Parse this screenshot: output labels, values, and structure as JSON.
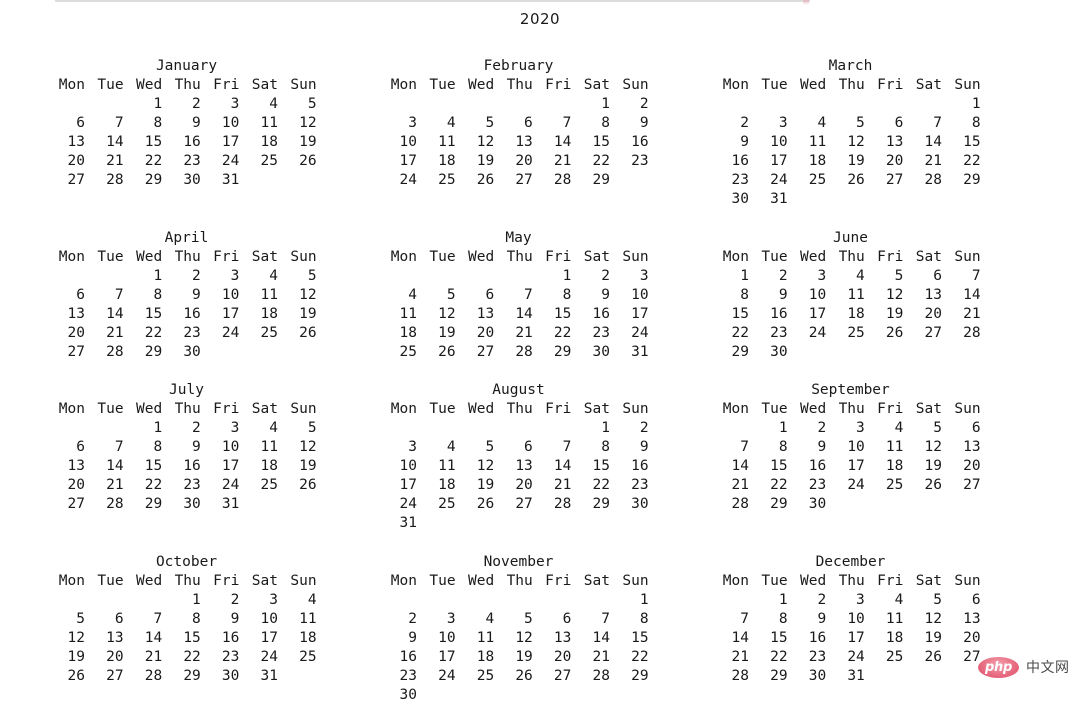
{
  "title": "2020",
  "watermark": {
    "badge_text": "php",
    "text": "中文网",
    "badge_color": "#dc4f68",
    "text_color": "#4a4a4a"
  },
  "calendar": {
    "year": "2020",
    "first_weekday": "Mon",
    "weekday_headers": [
      "Mon",
      "Tue",
      "Wed",
      "Thu",
      "Fri",
      "Sat",
      "Sun"
    ],
    "columns": 3,
    "rows": 4,
    "months": [
      {
        "name": "January",
        "index": 1,
        "weeks": [
          [
            "",
            "",
            "1",
            "2",
            "3",
            "4",
            "5"
          ],
          [
            "6",
            "7",
            "8",
            "9",
            "10",
            "11",
            "12"
          ],
          [
            "13",
            "14",
            "15",
            "16",
            "17",
            "18",
            "19"
          ],
          [
            "20",
            "21",
            "22",
            "23",
            "24",
            "25",
            "26"
          ],
          [
            "27",
            "28",
            "29",
            "30",
            "31",
            "",
            ""
          ]
        ]
      },
      {
        "name": "February",
        "index": 2,
        "weeks": [
          [
            "",
            "",
            "",
            "",
            "",
            "1",
            "2"
          ],
          [
            "3",
            "4",
            "5",
            "6",
            "7",
            "8",
            "9"
          ],
          [
            "10",
            "11",
            "12",
            "13",
            "14",
            "15",
            "16"
          ],
          [
            "17",
            "18",
            "19",
            "20",
            "21",
            "22",
            "23"
          ],
          [
            "24",
            "25",
            "26",
            "27",
            "28",
            "29",
            ""
          ]
        ]
      },
      {
        "name": "March",
        "index": 3,
        "weeks": [
          [
            "",
            "",
            "",
            "",
            "",
            "",
            "1"
          ],
          [
            "2",
            "3",
            "4",
            "5",
            "6",
            "7",
            "8"
          ],
          [
            "9",
            "10",
            "11",
            "12",
            "13",
            "14",
            "15"
          ],
          [
            "16",
            "17",
            "18",
            "19",
            "20",
            "21",
            "22"
          ],
          [
            "23",
            "24",
            "25",
            "26",
            "27",
            "28",
            "29"
          ],
          [
            "30",
            "31",
            "",
            "",
            "",
            "",
            ""
          ]
        ]
      },
      {
        "name": "April",
        "index": 4,
        "weeks": [
          [
            "",
            "",
            "1",
            "2",
            "3",
            "4",
            "5"
          ],
          [
            "6",
            "7",
            "8",
            "9",
            "10",
            "11",
            "12"
          ],
          [
            "13",
            "14",
            "15",
            "16",
            "17",
            "18",
            "19"
          ],
          [
            "20",
            "21",
            "22",
            "23",
            "24",
            "25",
            "26"
          ],
          [
            "27",
            "28",
            "29",
            "30",
            "",
            "",
            ""
          ]
        ]
      },
      {
        "name": "May",
        "index": 5,
        "weeks": [
          [
            "",
            "",
            "",
            "",
            "1",
            "2",
            "3"
          ],
          [
            "4",
            "5",
            "6",
            "7",
            "8",
            "9",
            "10"
          ],
          [
            "11",
            "12",
            "13",
            "14",
            "15",
            "16",
            "17"
          ],
          [
            "18",
            "19",
            "20",
            "21",
            "22",
            "23",
            "24"
          ],
          [
            "25",
            "26",
            "27",
            "28",
            "29",
            "30",
            "31"
          ]
        ]
      },
      {
        "name": "June",
        "index": 6,
        "weeks": [
          [
            "1",
            "2",
            "3",
            "4",
            "5",
            "6",
            "7"
          ],
          [
            "8",
            "9",
            "10",
            "11",
            "12",
            "13",
            "14"
          ],
          [
            "15",
            "16",
            "17",
            "18",
            "19",
            "20",
            "21"
          ],
          [
            "22",
            "23",
            "24",
            "25",
            "26",
            "27",
            "28"
          ],
          [
            "29",
            "30",
            "",
            "",
            "",
            "",
            ""
          ]
        ]
      },
      {
        "name": "July",
        "index": 7,
        "weeks": [
          [
            "",
            "",
            "1",
            "2",
            "3",
            "4",
            "5"
          ],
          [
            "6",
            "7",
            "8",
            "9",
            "10",
            "11",
            "12"
          ],
          [
            "13",
            "14",
            "15",
            "16",
            "17",
            "18",
            "19"
          ],
          [
            "20",
            "21",
            "22",
            "23",
            "24",
            "25",
            "26"
          ],
          [
            "27",
            "28",
            "29",
            "30",
            "31",
            "",
            ""
          ]
        ]
      },
      {
        "name": "August",
        "index": 8,
        "weeks": [
          [
            "",
            "",
            "",
            "",
            "",
            "1",
            "2"
          ],
          [
            "3",
            "4",
            "5",
            "6",
            "7",
            "8",
            "9"
          ],
          [
            "10",
            "11",
            "12",
            "13",
            "14",
            "15",
            "16"
          ],
          [
            "17",
            "18",
            "19",
            "20",
            "21",
            "22",
            "23"
          ],
          [
            "24",
            "25",
            "26",
            "27",
            "28",
            "29",
            "30"
          ],
          [
            "31",
            "",
            "",
            "",
            "",
            "",
            ""
          ]
        ]
      },
      {
        "name": "September",
        "index": 9,
        "weeks": [
          [
            "",
            "1",
            "2",
            "3",
            "4",
            "5",
            "6"
          ],
          [
            "7",
            "8",
            "9",
            "10",
            "11",
            "12",
            "13"
          ],
          [
            "14",
            "15",
            "16",
            "17",
            "18",
            "19",
            "20"
          ],
          [
            "21",
            "22",
            "23",
            "24",
            "25",
            "26",
            "27"
          ],
          [
            "28",
            "29",
            "30",
            "",
            "",
            "",
            ""
          ]
        ]
      },
      {
        "name": "October",
        "index": 10,
        "weeks": [
          [
            "",
            "",
            "",
            "1",
            "2",
            "3",
            "4"
          ],
          [
            "5",
            "6",
            "7",
            "8",
            "9",
            "10",
            "11"
          ],
          [
            "12",
            "13",
            "14",
            "15",
            "16",
            "17",
            "18"
          ],
          [
            "19",
            "20",
            "21",
            "22",
            "23",
            "24",
            "25"
          ],
          [
            "26",
            "27",
            "28",
            "29",
            "30",
            "31",
            ""
          ]
        ]
      },
      {
        "name": "November",
        "index": 11,
        "weeks": [
          [
            "",
            "",
            "",
            "",
            "",
            "",
            "1"
          ],
          [
            "2",
            "3",
            "4",
            "5",
            "6",
            "7",
            "8"
          ],
          [
            "9",
            "10",
            "11",
            "12",
            "13",
            "14",
            "15"
          ],
          [
            "16",
            "17",
            "18",
            "19",
            "20",
            "21",
            "22"
          ],
          [
            "23",
            "24",
            "25",
            "26",
            "27",
            "28",
            "29"
          ],
          [
            "30",
            "",
            "",
            "",
            "",
            "",
            ""
          ]
        ]
      },
      {
        "name": "December",
        "index": 12,
        "weeks": [
          [
            "",
            "1",
            "2",
            "3",
            "4",
            "5",
            "6"
          ],
          [
            "7",
            "8",
            "9",
            "10",
            "11",
            "12",
            "13"
          ],
          [
            "14",
            "15",
            "16",
            "17",
            "18",
            "19",
            "20"
          ],
          [
            "21",
            "22",
            "23",
            "24",
            "25",
            "26",
            "27"
          ],
          [
            "28",
            "29",
            "30",
            "31",
            "",
            "",
            ""
          ]
        ]
      }
    ]
  }
}
